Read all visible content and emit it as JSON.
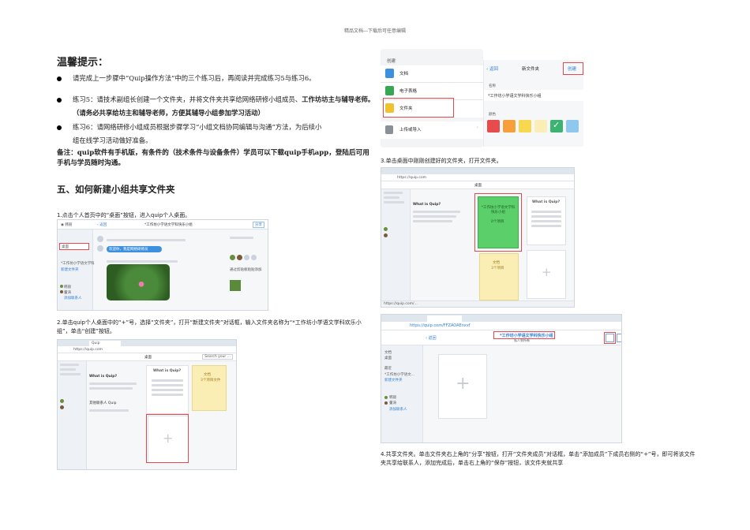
{
  "header": "精品文档---下载后可任意编辑",
  "tips": {
    "title": "温馨提示：",
    "items": [
      "请完成上一步骤中“Quip操作方法”中的三个练习后，再阅读并完成练习5与练习6。",
      "练习5：请技术副组长创建一个文件夹，并将文件夹共享给网络研修小组成员、",
      "工作坊坊主与辅导老师。",
      "（请务必共享给坊主和辅导老师，方便其辅导小组参加学习活动）",
      "练习6：请网络研修小组成员根据步骤学习“小组文档协同编辑与沟通”方法，为后续小",
      "组在线学习活动做好准备。"
    ],
    "note": "备注：quip软件有手机版，有条件的（技术条件与设备条件）学员可以下载quip手机app，登陆后可用手机与学员随时沟通。"
  },
  "section_title": "五、如何新建小组共享文件夹",
  "steps": {
    "s1": "1.点击个人首页中的“桌面”按钮，进入quip个人桌面。",
    "s2": "2.单击quip个人桌面中的“+”号，选择“文件夹”，打开“新建文件夹”对话框，输入文件夹名称为“*工作坊小学语文学科欢乐小组”，单击“创建”按钮。",
    "s3": "3.单击桌面中刚刚创建好的文件夹，打开文件夹。",
    "s4": "4.共享文件夹。单击文件夹右上角的“分享”按钮，打开“文件夹成员”对话框，单击“添加成员”下成员右侧的“+”号，即可将该文件夹共享给联系人，添加完成后，单击右上角的“保存”按钮，该文件夹就共享"
  },
  "shot1": {
    "back": "返回",
    "title": "*工作坊小学语文学科快乐小组",
    "share": "分享",
    "side_desktop": "桌面",
    "side_folder": "*工作坊小学语文学科",
    "side_new": "新建文件夹",
    "members": [
      "韩丽",
      "董涛",
      "添加联系人"
    ],
    "chat": "欢迎你，我是网络研修员",
    "attach": "通过剪贴板粘贴添加"
  },
  "shot2": {
    "url": "https://quip.com",
    "tab": "Quip",
    "desktop": "桌面",
    "search": "Search your ...",
    "doc_title": "What is Quip?",
    "other": "其他联系人 Quip",
    "folder": "文档",
    "folder_sub": "3个项目文件"
  },
  "menu": {
    "header": "创建",
    "items": [
      "文档",
      "电子表格",
      "文件夹",
      "上传或导入"
    ]
  },
  "newfolder": {
    "back": "返回",
    "title": "新文件夹",
    "create": "创建",
    "name_label": "名称",
    "name_value": "*工作坊小学语文学科快乐小组",
    "color_label": "颜色",
    "colors": [
      "#e84b4b",
      "#f5a03b",
      "#f7d84e",
      "#f9efb6",
      "#3cb371",
      "#8ec8f0"
    ]
  },
  "shot3": {
    "url": "https://quip.com",
    "desktop": "桌面",
    "folder_name": "*工作坊小学语文学科快乐小组",
    "folder_sub": "0个项目",
    "doc_folder": "文档",
    "doc_sub": "3个项目",
    "doc_title": "What is Quip?",
    "status": "https://quip.com/..."
  },
  "shot4": {
    "url": "https://quip.com/FFZAOAEnxxf",
    "back": "返回",
    "title": "*工作坊小学语文学科快乐小组",
    "subtitle": "私人到所有",
    "side": [
      "文档",
      "桌面",
      "最近",
      "新建文件夹"
    ],
    "members": [
      "韩丽",
      "董涛",
      "添加联系人"
    ],
    "side_folder": "*工作坊小学语文..."
  }
}
